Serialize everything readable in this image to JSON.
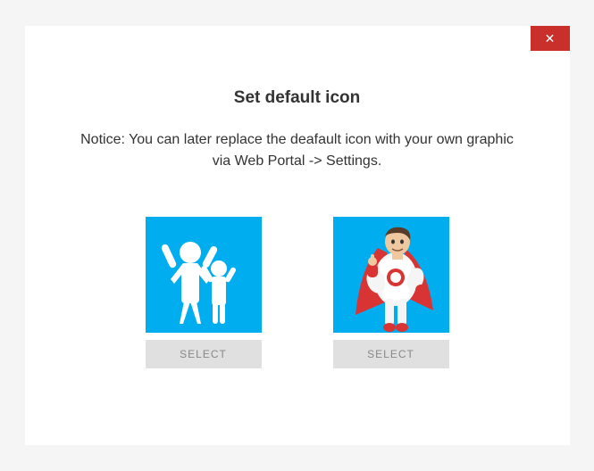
{
  "dialog": {
    "title": "Set default icon",
    "notice": "Notice: You can later replace the deafault icon with your own graphic via Web Portal -> Settings.",
    "close_label": "✕"
  },
  "options": [
    {
      "icon_name": "family-silhouette-icon",
      "select_label": "SELECT"
    },
    {
      "icon_name": "superhero-icon",
      "select_label": "SELECT"
    }
  ],
  "colors": {
    "icon_bg": "#00aeef",
    "close_bg": "#c9302c",
    "button_bg": "#e0e0e0"
  }
}
